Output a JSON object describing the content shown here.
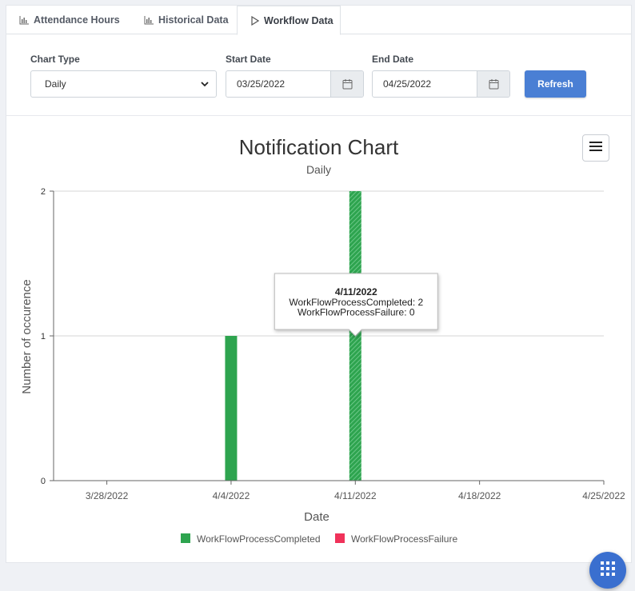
{
  "tabs": [
    {
      "label": "Attendance Hours",
      "icon": "bar-chart-icon"
    },
    {
      "label": "Historical Data",
      "icon": "bar-chart-icon"
    },
    {
      "label": "Workflow Data",
      "icon": "play-icon",
      "active": true
    }
  ],
  "form": {
    "chart_type_label": "Chart Type",
    "chart_type_value": "Daily",
    "start_date_label": "Start Date",
    "start_date_value": "03/25/2022",
    "end_date_label": "End Date",
    "end_date_value": "04/25/2022",
    "refresh_label": "Refresh"
  },
  "colors": {
    "accent": "#4a7fd4",
    "completed": "#2ea44f",
    "failure": "#f0325a"
  },
  "chart_data": {
    "type": "bar",
    "title": "Notification Chart",
    "subtitle": "Daily",
    "xlabel": "Date",
    "ylabel": "Number of occurence",
    "ylim": [
      0,
      2
    ],
    "yticks": [
      0,
      1,
      2
    ],
    "xlim": [
      "3/25/2022",
      "4/25/2022"
    ],
    "xticks": [
      "3/28/2022",
      "4/4/2022",
      "4/11/2022",
      "4/18/2022",
      "4/25/2022"
    ],
    "grid": true,
    "legend_position": "bottom-center",
    "series": [
      {
        "name": "WorkFlowProcessCompleted",
        "color": "#2ea44f",
        "points": [
          {
            "x": "4/4/2022",
            "y": 1
          },
          {
            "x": "4/11/2022",
            "y": 2
          }
        ]
      },
      {
        "name": "WorkFlowProcessFailure",
        "color": "#f0325a",
        "points": [
          {
            "x": "4/4/2022",
            "y": 0
          },
          {
            "x": "4/11/2022",
            "y": 0
          }
        ]
      }
    ],
    "tooltip": {
      "date": "4/11/2022",
      "lines": [
        "WorkFlowProcessCompleted: 2",
        "WorkFlowProcessFailure: 0"
      ]
    }
  }
}
